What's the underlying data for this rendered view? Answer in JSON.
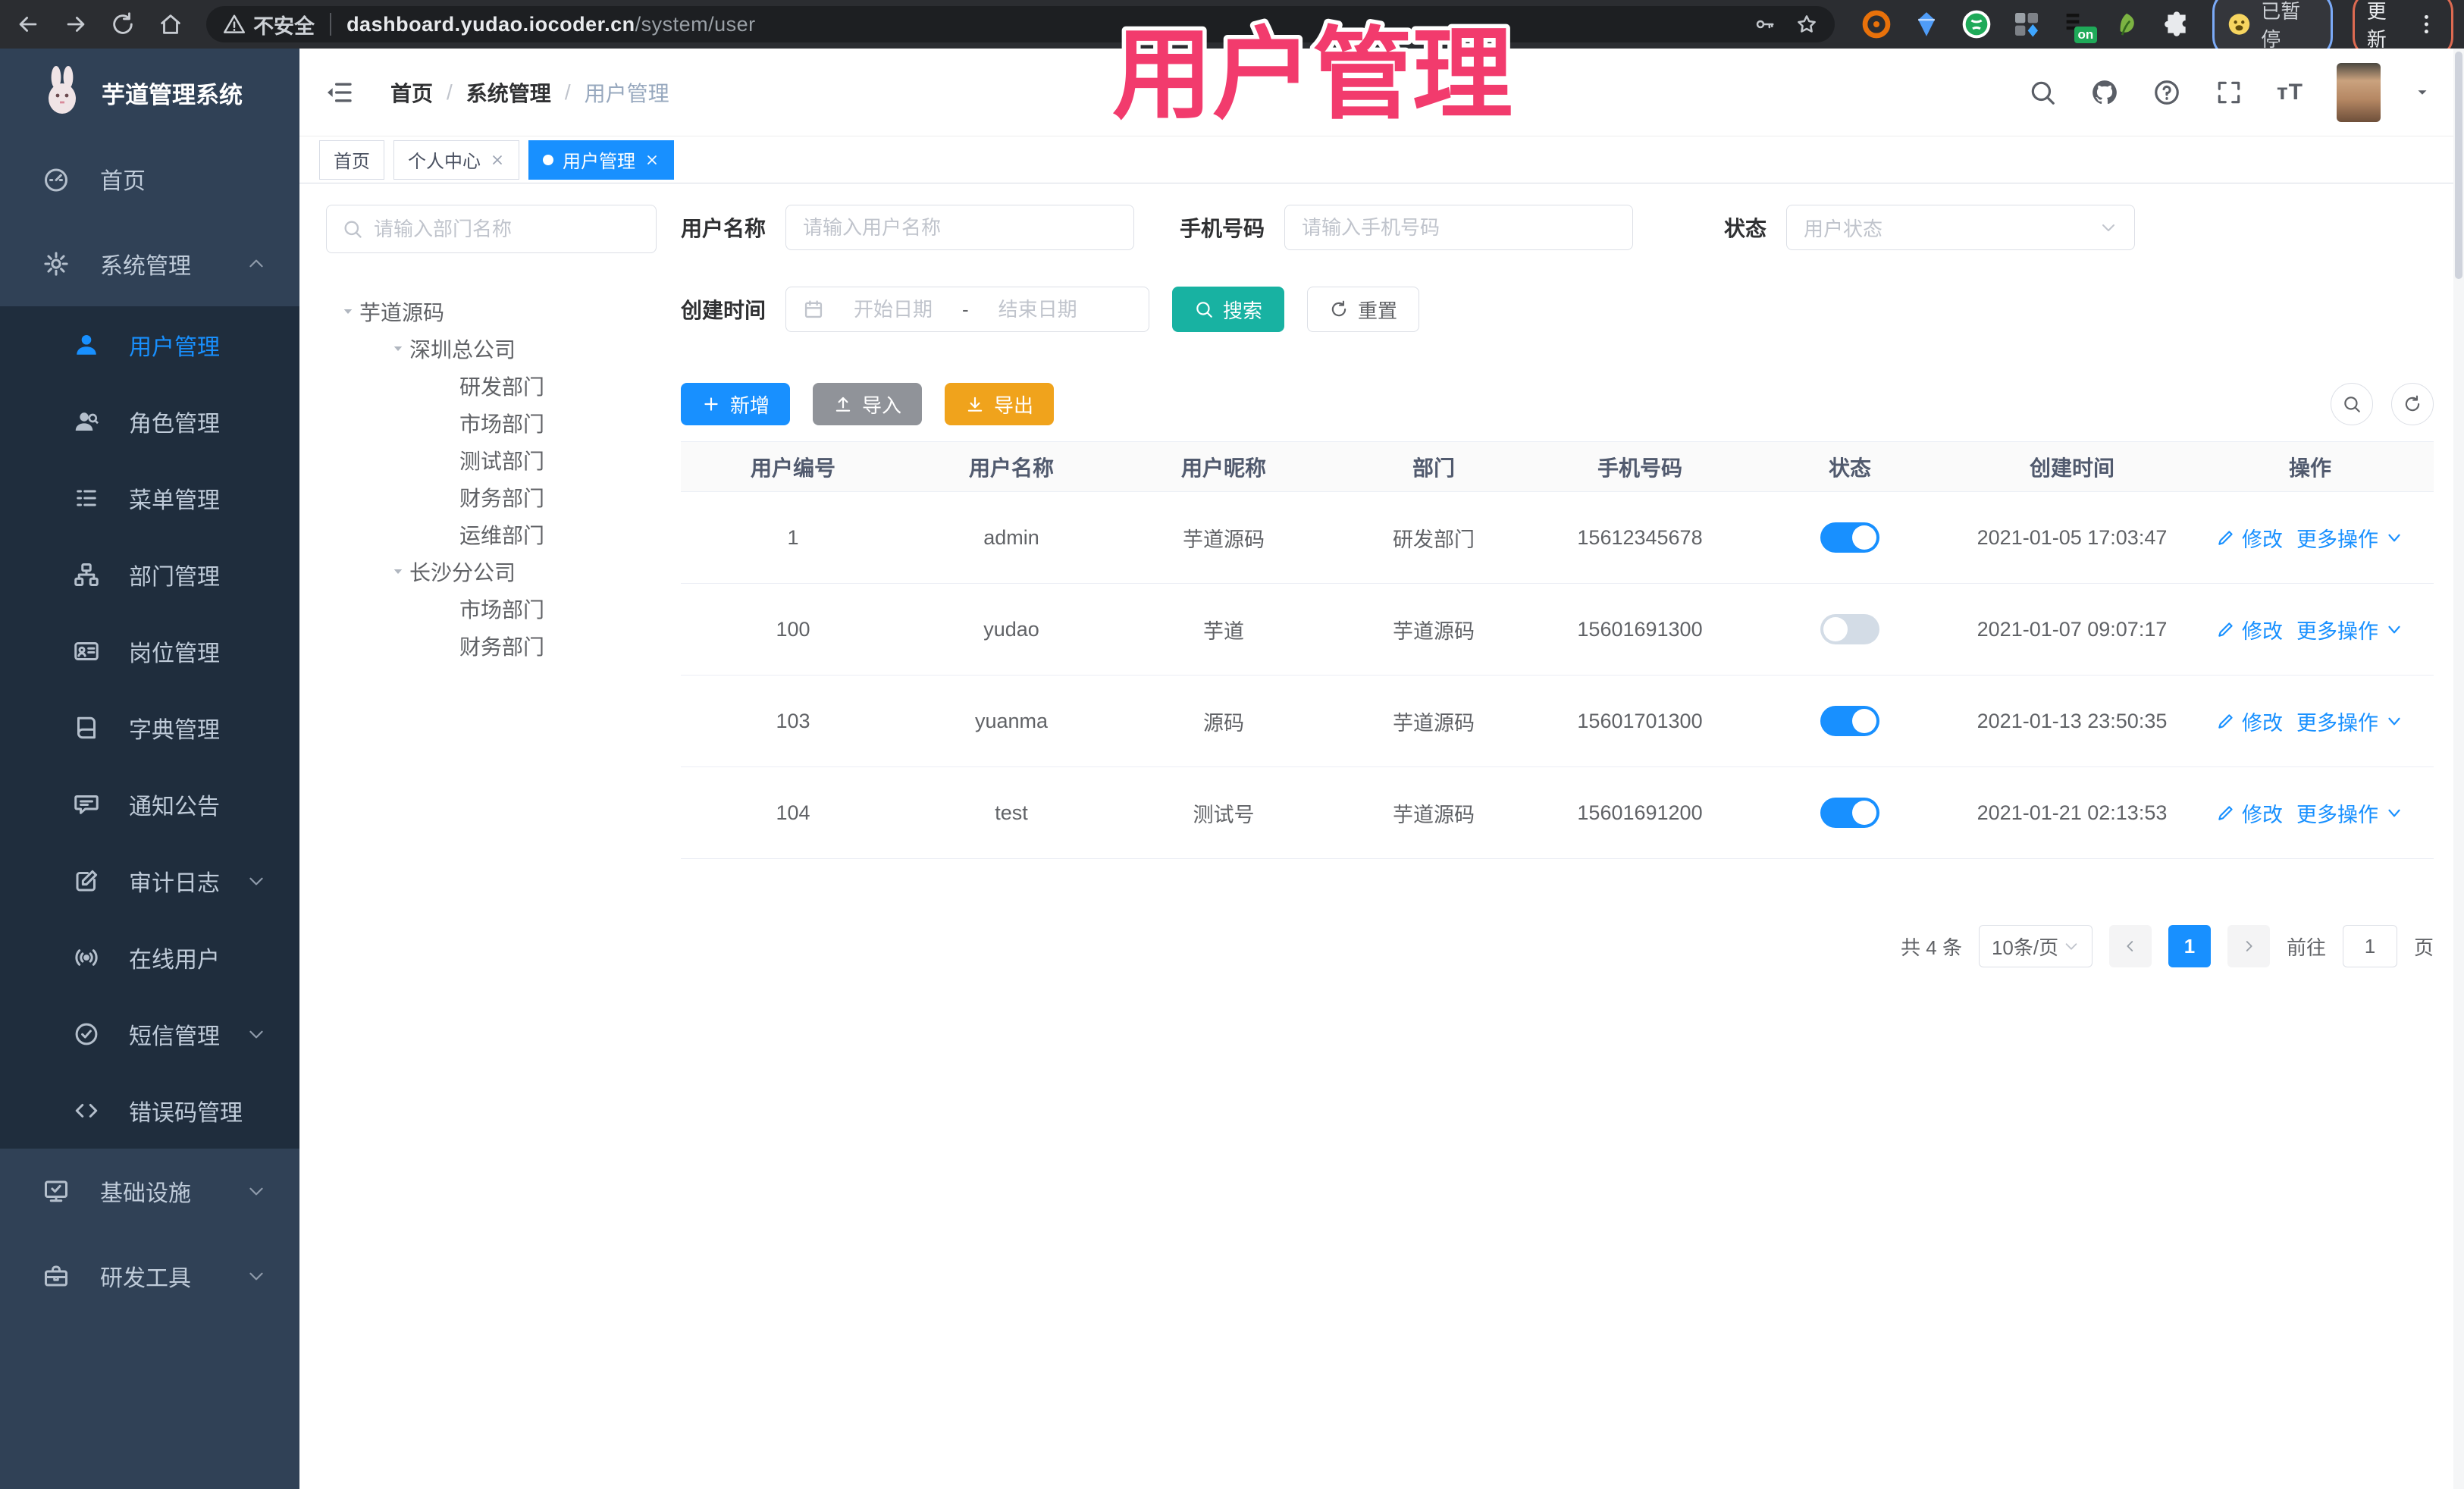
{
  "browser": {
    "security": "不安全",
    "url_host": "dashboard.yudao.iocoder.cn",
    "url_path": "/system/user",
    "profile_label": "已暂停",
    "update_label": "更新",
    "ext_badge": "on"
  },
  "overlay": {
    "title": "用户管理",
    "color": "#f23b6d"
  },
  "logo": {
    "title": "芋道管理系统"
  },
  "breadcrumb": {
    "sep": "/",
    "items": [
      "首页",
      "系统管理",
      "用户管理"
    ]
  },
  "tabs": [
    {
      "label": "首页"
    },
    {
      "label": "个人中心"
    },
    {
      "label": "用户管理"
    }
  ],
  "sidebar": {
    "home": "首页",
    "system": "系统管理",
    "submenu": [
      "用户管理",
      "角色管理",
      "菜单管理",
      "部门管理",
      "岗位管理",
      "字典管理",
      "通知公告",
      "审计日志",
      "在线用户",
      "短信管理",
      "错误码管理"
    ],
    "infra": "基础设施",
    "devtools": "研发工具"
  },
  "tree": {
    "placeholder": "请输入部门名称",
    "nodes": [
      "芋道源码",
      "深圳总公司",
      "研发部门",
      "市场部门",
      "测试部门",
      "财务部门",
      "运维部门",
      "长沙分公司",
      "市场部门",
      "财务部门"
    ]
  },
  "filters": {
    "username_label": "用户名称",
    "username_placeholder": "请输入用户名称",
    "mobile_label": "手机号码",
    "mobile_placeholder": "请输入手机号码",
    "status_label": "状态",
    "status_placeholder": "用户状态",
    "time_label": "创建时间",
    "start_placeholder": "开始日期",
    "range_sep": "-",
    "end_placeholder": "结束日期",
    "search": "搜索",
    "reset": "重置"
  },
  "toolbar": {
    "add": "新增",
    "import": "导入",
    "export": "导出"
  },
  "table": {
    "columns": [
      "用户编号",
      "用户名称",
      "用户昵称",
      "部门",
      "手机号码",
      "状态",
      "创建时间",
      "操作"
    ],
    "edit": "修改",
    "more": "更多操作",
    "rows": [
      {
        "id": "1",
        "username": "admin",
        "nickname": "芋道源码",
        "dept": "研发部门",
        "mobile": "15612345678",
        "status": "on",
        "created": "2021-01-05 17:03:47"
      },
      {
        "id": "100",
        "username": "yudao",
        "nickname": "芋道",
        "dept": "芋道源码",
        "mobile": "15601691300",
        "status": "off",
        "created": "2021-01-07 09:07:17"
      },
      {
        "id": "103",
        "username": "yuanma",
        "nickname": "源码",
        "dept": "芋道源码",
        "mobile": "15601701300",
        "status": "on",
        "created": "2021-01-13 23:50:35"
      },
      {
        "id": "104",
        "username": "test",
        "nickname": "测试号",
        "dept": "芋道源码",
        "mobile": "15601691200",
        "status": "on",
        "created": "2021-01-21 02:13:53"
      }
    ]
  },
  "pagination": {
    "total": "共 4 条",
    "page_size": "10条/页",
    "page": "1",
    "goto": "前往",
    "goto_value": "1",
    "unit": "页"
  }
}
